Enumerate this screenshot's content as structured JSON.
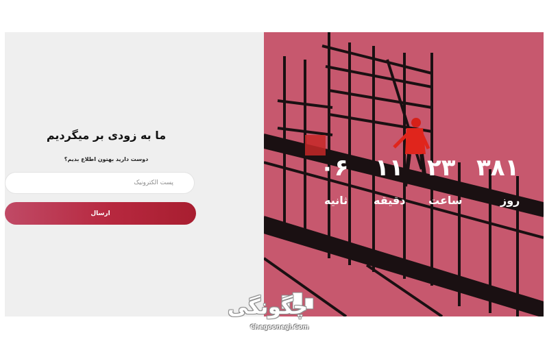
{
  "subscribe": {
    "heading": "ما به زودی بر میگردیم",
    "subheading": "دوست دارید بهتون اطلاع بدیم؟",
    "email_placeholder": "پست الکترونیک",
    "submit_label": "ارسال"
  },
  "countdown": {
    "days_value": "۳۸۱",
    "days_label": "روز",
    "hours_value": "۲۳",
    "hours_label": "ساعت",
    "minutes_value": "۱۱",
    "minutes_label": "دقیقه",
    "seconds_value": "۰۶",
    "seconds_label": "ثانیه"
  },
  "watermark": {
    "brand": "چگونگی",
    "url": "Chegoonegi.Com"
  },
  "colors": {
    "accent": "#b7283f",
    "hero_tint": "#c7586e",
    "panel_bg": "#efefef"
  }
}
